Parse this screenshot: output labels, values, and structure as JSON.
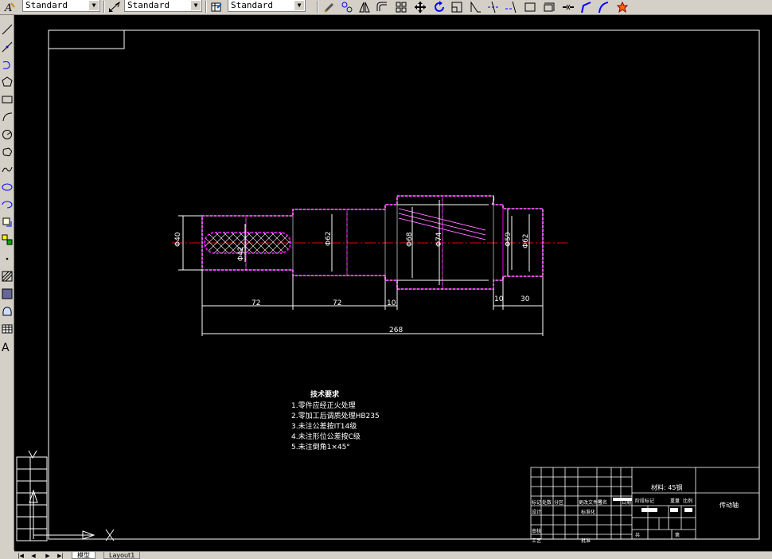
{
  "toolbar": {
    "text_style": "Standard",
    "dim_style": "Standard",
    "table_style": "Standard",
    "tools": [
      "edit-icon",
      "multiline-edit-icon",
      "mirror-icon",
      "offset-icon",
      "array-icon",
      "move-icon",
      "rotate-icon",
      "scale-icon",
      "stretch-icon",
      "trim-icon",
      "extend-icon",
      "break-icon",
      "join-icon",
      "chamfer-icon",
      "fillet-icon",
      "explode-icon"
    ]
  },
  "left_toolbar": {
    "tools": [
      "line-icon",
      "construction-line-icon",
      "polyline-icon",
      "polygon-icon",
      "rectangle-icon",
      "arc-icon",
      "circle-icon",
      "revision-cloud-icon",
      "spline-icon",
      "ellipse-icon",
      "ellipse-arc-icon",
      "insert-block-icon",
      "make-block-icon",
      "point-icon",
      "hatch-icon",
      "gradient-icon",
      "region-icon",
      "table-icon",
      "multiline-text-icon"
    ]
  },
  "drawing": {
    "dimensions": {
      "d1": "72",
      "d2": "72",
      "d3": "10",
      "d4": "10",
      "d5": "30",
      "total": "268",
      "dia_left": "Φ40",
      "dia_key": "Φ42",
      "dia_mid": "Φ62",
      "dia_collar": "Φ68",
      "dia_large": "Φ74",
      "dia_step": "Φ59",
      "dia_right": "Φ62"
    },
    "tech_requirements": {
      "title": "技术要求",
      "items": [
        "1.零件应经正火处理",
        "2.零加工后调质处理HB235",
        "3.未注公差按IT14级",
        "4.未注形位公差按C级",
        "5.未注倒角1×45°"
      ]
    },
    "title_block": {
      "material": "材料: 45钢",
      "part_name": "传动轴",
      "labels": {
        "mark": "标记",
        "count": "处数",
        "zone": "分区",
        "change_doc": "更改文件号",
        "signature": "签名",
        "date": "日期",
        "design": "设计",
        "standardize": "标准化",
        "review": "审核",
        "process": "工艺",
        "approve": "批准",
        "stage_mark": "阶段标记",
        "weight": "重量",
        "scale": "比例",
        "sheets": "共",
        "sheet": "第"
      }
    }
  },
  "layout_tabs": {
    "model": "模型",
    "layout1": "Layout1"
  }
}
